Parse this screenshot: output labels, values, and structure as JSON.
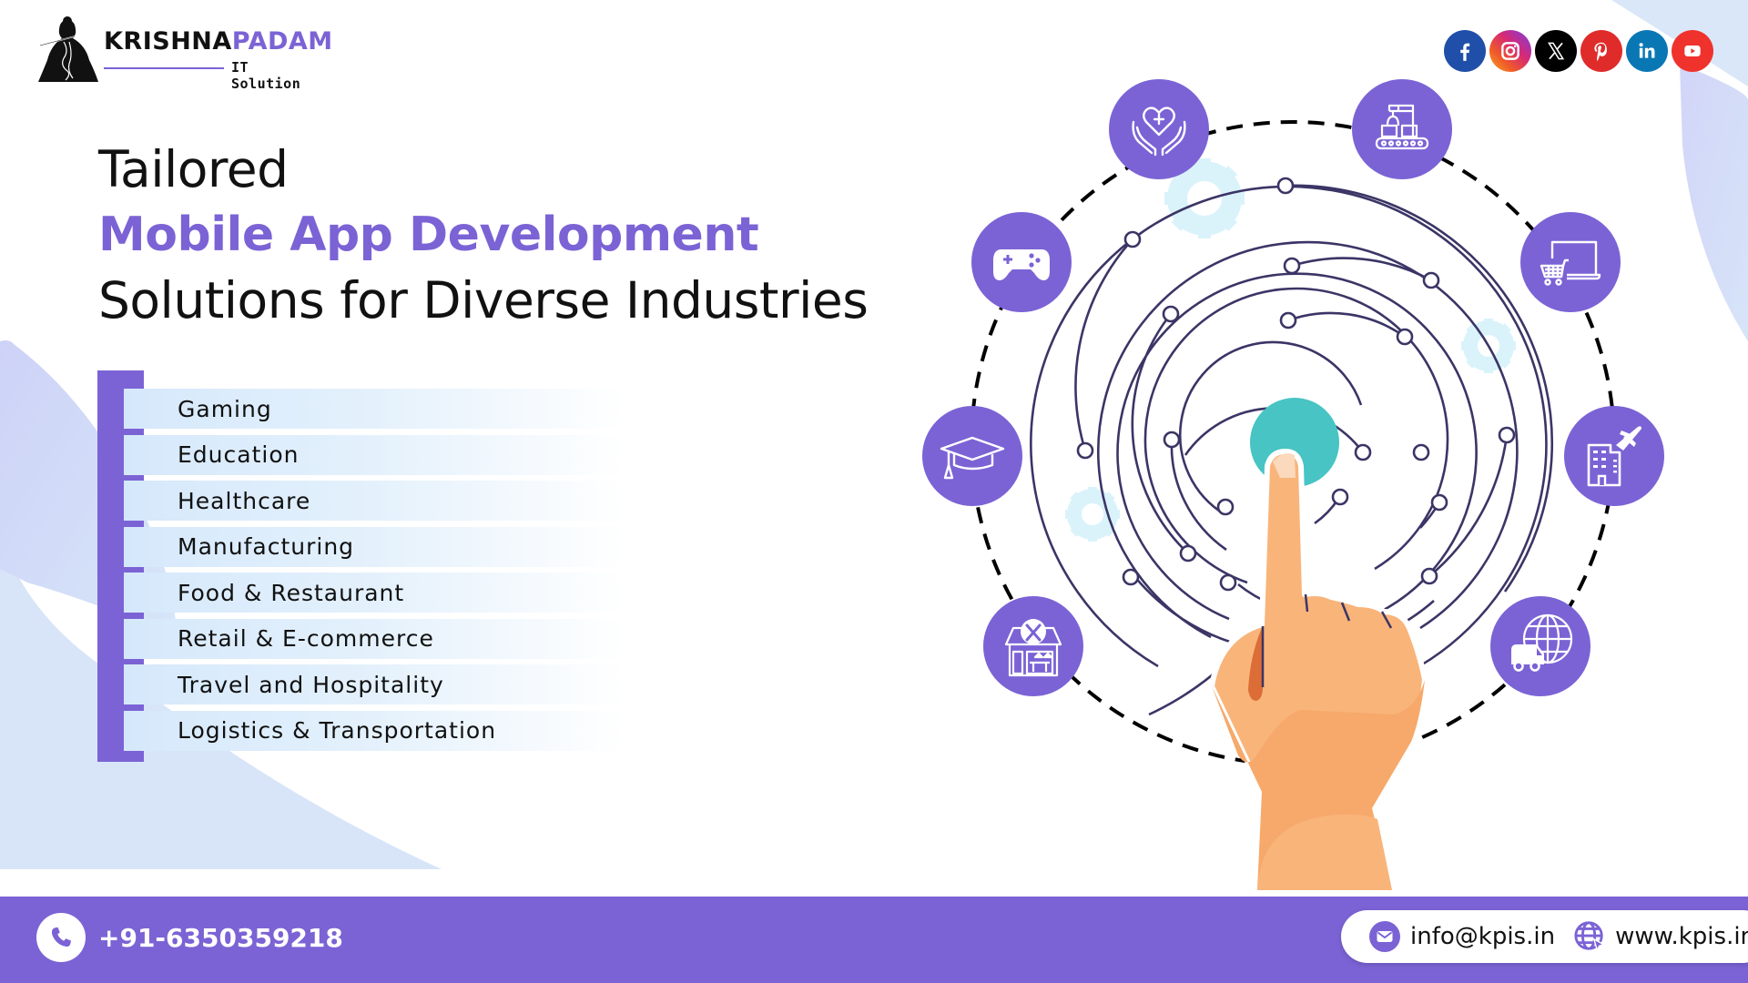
{
  "brand": {
    "name_primary": "KRISHNA",
    "name_accent": "PADAM",
    "tagline": "IT Solution"
  },
  "social": [
    {
      "name": "facebook",
      "icon": "facebook-icon",
      "color": "#1F4FA8"
    },
    {
      "name": "instagram",
      "icon": "instagram-icon",
      "color": "#D62976"
    },
    {
      "name": "x",
      "icon": "x-icon",
      "color": "#000000"
    },
    {
      "name": "pinterest",
      "icon": "pinterest-icon",
      "color": "#E02B2B"
    },
    {
      "name": "linkedin",
      "icon": "linkedin-icon",
      "color": "#0A77B5"
    },
    {
      "name": "youtube",
      "icon": "youtube-icon",
      "color": "#F0322C"
    }
  ],
  "headline": {
    "line1": "Tailored",
    "line2": "Mobile App Development",
    "line3": "Solutions for Diverse Industries"
  },
  "industries": [
    {
      "label": "Gaming",
      "icon": "gamepad-icon"
    },
    {
      "label": "Education",
      "icon": "graduation-cap-icon"
    },
    {
      "label": "Healthcare",
      "icon": "heart-hands-icon"
    },
    {
      "label": "Manufacturing",
      "icon": "factory-conveyor-icon"
    },
    {
      "label": "Food & Restaurant",
      "icon": "restaurant-icon"
    },
    {
      "label": "Retail & E-commerce",
      "icon": "laptop-cart-icon"
    },
    {
      "label": "Travel and Hospitality",
      "icon": "hotel-plane-icon"
    },
    {
      "label": "Logistics & Transportation",
      "icon": "globe-truck-icon"
    }
  ],
  "contact": {
    "phone": "+91-6350359218",
    "email": "info@kpis.in",
    "website": "www.kpis.in"
  },
  "colors": {
    "accent": "#7B63D5",
    "teal": "#47C4C3",
    "line": "#3B3566",
    "skin": "#F9B47A",
    "gear": "#DAF3FB"
  }
}
